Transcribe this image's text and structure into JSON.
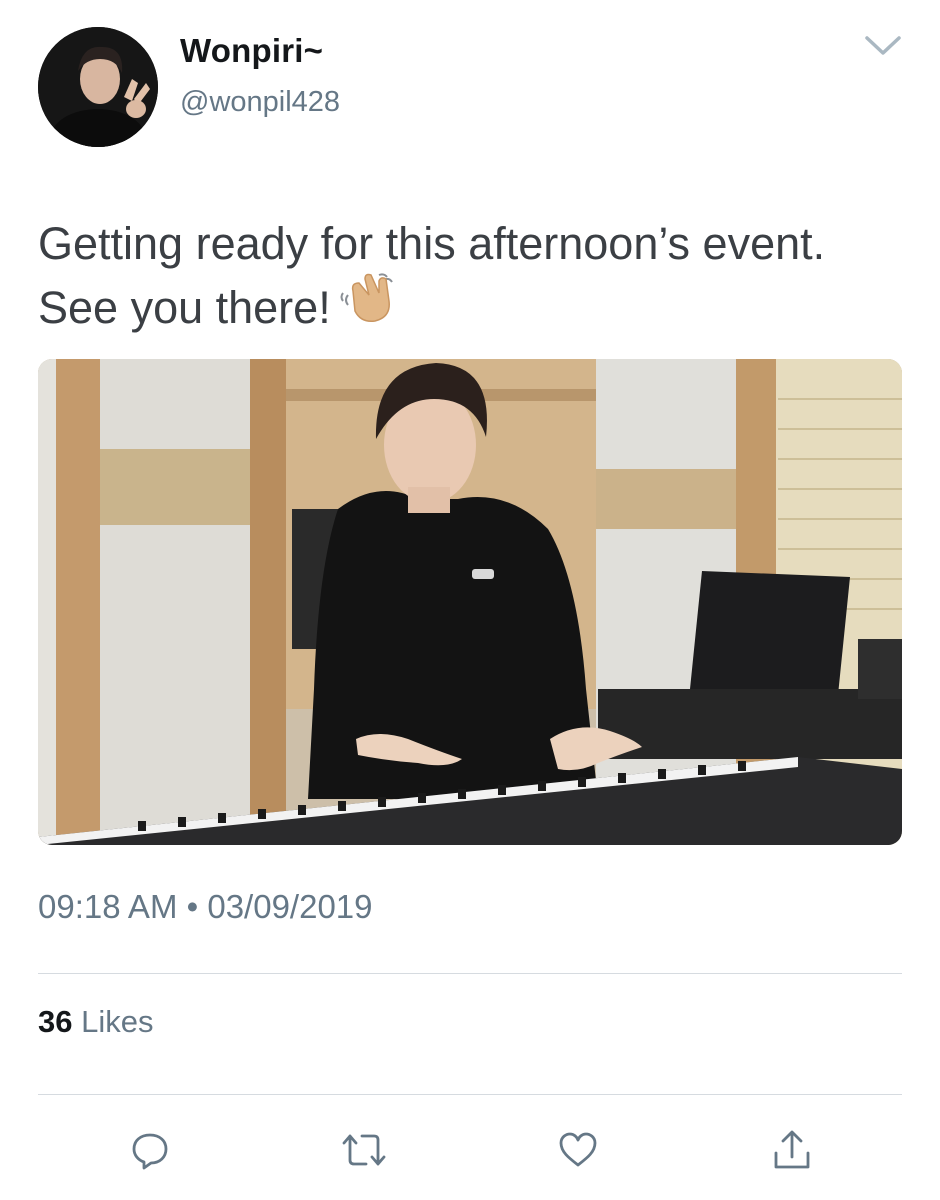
{
  "user": {
    "display_name": "Wonpiri~",
    "handle": "@wonpil428"
  },
  "tweet": {
    "text": "Getting ready for this afternoon’s event. See you there!",
    "emoji": "waving-hand-emoji",
    "time": "09:18 AM",
    "separator": "•",
    "date": "03/09/2019"
  },
  "stats": {
    "likes_count": "36",
    "likes_label": "Likes"
  },
  "icons": {
    "menu": "chevron-down-icon",
    "reply": "reply-icon",
    "retweet": "retweet-icon",
    "like": "heart-icon",
    "share": "share-icon"
  },
  "colors": {
    "text_primary": "#14171a",
    "text_secondary": "#657786",
    "divider": "#d6dbe0"
  }
}
